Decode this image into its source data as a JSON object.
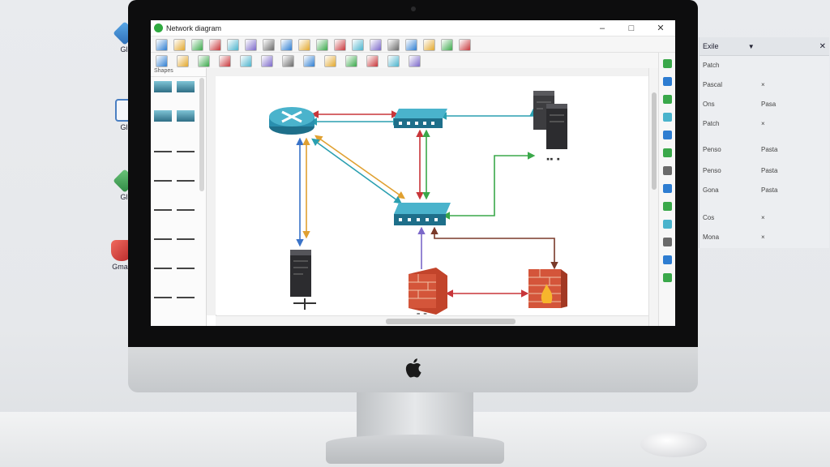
{
  "app": {
    "title": "Network diagram",
    "window_controls": {
      "minimize": "–",
      "maximize": "□",
      "close": "✕"
    }
  },
  "toolbar_icons_row1": [
    "save-icon",
    "open-folder-icon",
    "folder-icon",
    "page-icon",
    "zoom-icon",
    "image-icon",
    "redo-icon",
    "pointer-icon",
    "connector-icon",
    "shape-icon",
    "layers-icon",
    "table-icon",
    "grid-icon",
    "align-icon",
    "globe-icon",
    "share-icon",
    "arrow-icon",
    "dropdown-icon"
  ],
  "toolbar_icons_row2": [
    "pointer-icon",
    "text-icon",
    "folder-icon",
    "undo-icon",
    "line-icon",
    "pen-icon",
    "crop-icon",
    "fill-icon",
    "connect-icon",
    "frame-icon",
    "select-icon",
    "magic-icon",
    "arrange-icon"
  ],
  "palette": {
    "header": "Shapes"
  },
  "desktop_icons": [
    {
      "label": "Gli",
      "icon": "cube-icon",
      "color": "#3a8fd6"
    },
    {
      "label": "Gli",
      "icon": "document-icon",
      "color": "#4a7fc2"
    },
    {
      "label": "Gli",
      "icon": "cube-icon",
      "color": "#4aa35a"
    },
    {
      "label": "Gmail",
      "icon": "shield-icon",
      "color": "#d8403b"
    }
  ],
  "side_panel": {
    "header": "Exile",
    "rows": [
      {
        "label": "Patch",
        "value": ""
      },
      {
        "label": "Pascal",
        "value": "×"
      },
      {
        "label": "Ons",
        "value": "Pasa"
      },
      {
        "label": "Patch",
        "value": "×"
      },
      {
        "label": "Penso",
        "value": "Pasta"
      },
      {
        "label": "Penso",
        "value": "Pasta"
      },
      {
        "label": "Gona",
        "value": "Pasta"
      },
      {
        "label": "Cos",
        "value": "×"
      },
      {
        "label": "Mona",
        "value": "×"
      }
    ]
  },
  "diagram": {
    "nodes": [
      {
        "type": "router"
      },
      {
        "type": "switch"
      },
      {
        "type": "switch"
      },
      {
        "type": "server-pair"
      },
      {
        "type": "server"
      },
      {
        "type": "firewall"
      },
      {
        "type": "firewall"
      }
    ],
    "link_colors": {
      "red": "#c8363a",
      "green": "#3aa84a",
      "blue": "#3a73c8",
      "orange": "#e0a030",
      "purple": "#7b68c9",
      "teal": "#2a9fb0",
      "brown": "#7a3a2a"
    }
  }
}
